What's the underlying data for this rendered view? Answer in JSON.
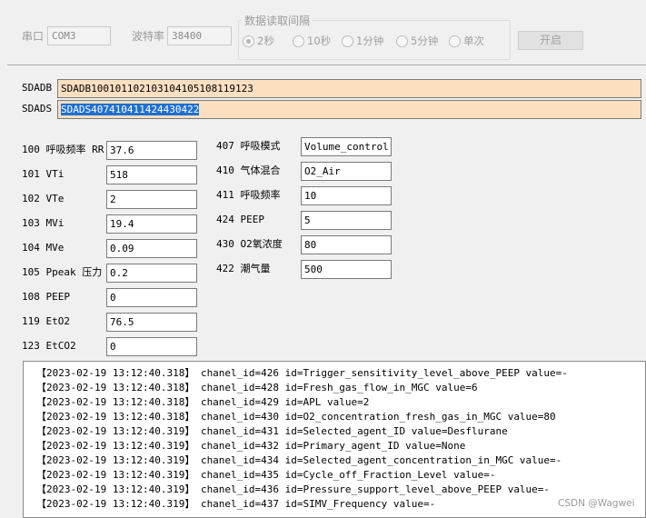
{
  "top": {
    "port_label": "串口",
    "port_value": "COM3",
    "baud_label": "波特率",
    "baud_value": "38400",
    "interval_group_title": "数据读取间隔",
    "interval_options": [
      "2秒",
      "10秒",
      "1分钟",
      "5分钟",
      "单次"
    ],
    "interval_selected": "2秒",
    "start_button": "开启"
  },
  "hex": {
    "sdadb_label": "SDADB",
    "sdadb_value": "SDADB100101102103104105108119123",
    "sdads_label": "SDADS",
    "sdads_value": "SDADS407410411424430422"
  },
  "params_left": [
    {
      "label": "100 呼吸频率 RR",
      "value": "37.6"
    },
    {
      "label": "101 VTi",
      "value": "518"
    },
    {
      "label": "102 VTe",
      "value": "2"
    },
    {
      "label": "103 MVi",
      "value": "19.4"
    },
    {
      "label": "104 MVe",
      "value": "0.09"
    },
    {
      "label": "105 Ppeak 压力",
      "value": "0.2"
    },
    {
      "label": "108 PEEP",
      "value": "0"
    },
    {
      "label": "119 EtO2",
      "value": "76.5"
    },
    {
      "label": "123 EtCO2",
      "value": "0"
    }
  ],
  "params_right": [
    {
      "label": "407 呼吸模式",
      "value": "Volume_control"
    },
    {
      "label": "410 气体混合",
      "value": "O2_Air"
    },
    {
      "label": "411 呼吸频率",
      "value": "10"
    },
    {
      "label": "424 PEEP",
      "value": "5"
    },
    {
      "label": "430 O2氧浓度",
      "value": "80"
    },
    {
      "label": "422 潮气量",
      "value": "500"
    }
  ],
  "log": [
    "【2023-02-19 13:12:40.318】 chanel_id=426 id=Trigger_sensitivity_level_above_PEEP value=-",
    "【2023-02-19 13:12:40.318】 chanel_id=428 id=Fresh_gas_flow_in_MGC value=6",
    "【2023-02-19 13:12:40.318】 chanel_id=429 id=APL value=2",
    "【2023-02-19 13:12:40.318】 chanel_id=430 id=O2_concentration_fresh_gas_in_MGC value=80",
    "【2023-02-19 13:12:40.319】 chanel_id=431 id=Selected_agent_ID value=Desflurane",
    "【2023-02-19 13:12:40.319】 chanel_id=432 id=Primary_agent_ID value=None",
    "【2023-02-19 13:12:40.319】 chanel_id=434 id=Selected_agent_concentration_in_MGC value=-",
    "【2023-02-19 13:12:40.319】 chanel_id=435 id=Cycle_off_Fraction_Level value=-",
    "【2023-02-19 13:12:40.319】 chanel_id=436 id=Pressure_support_level_above_PEEP value=-",
    "【2023-02-19 13:12:40.319】 chanel_id=437 id=SIMV_Frequency value=-"
  ],
  "watermark": "CSDN @Wagwei"
}
